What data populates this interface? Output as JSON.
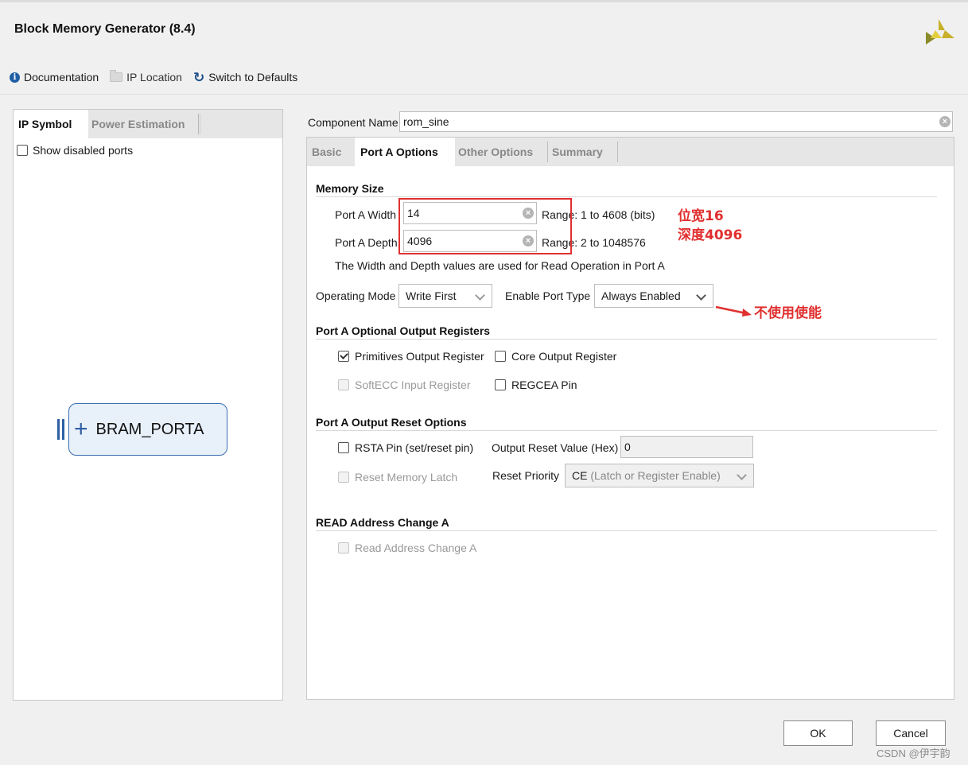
{
  "window": {
    "title": "Block Memory Generator (8.4)"
  },
  "toolbar": {
    "documentation": "Documentation",
    "ip_location": "IP Location",
    "switch_defaults": "Switch to Defaults"
  },
  "left_panel": {
    "tabs": [
      "IP Symbol",
      "Power Estimation"
    ],
    "show_disabled_ports": "Show disabled ports",
    "symbol": {
      "plus": "+",
      "label": "BRAM_PORTA"
    }
  },
  "component": {
    "label": "Component Name",
    "value": "rom_sine"
  },
  "right_tabs": [
    "Basic",
    "Port A Options",
    "Other Options",
    "Summary"
  ],
  "memory_size": {
    "title": "Memory Size",
    "width_label": "Port A Width",
    "width_value": "14",
    "width_range": "Range: 1 to 4608 (bits)",
    "depth_label": "Port A Depth",
    "depth_value": "4096",
    "depth_range": "Range: 2 to 1048576",
    "note": "The Width and Depth values are used for Read Operation in Port A"
  },
  "operating": {
    "mode_label": "Operating Mode",
    "mode_value": "Write First",
    "port_type_label": "Enable Port Type",
    "port_type_value": "Always Enabled"
  },
  "output_registers": {
    "title": "Port A Optional Output Registers",
    "primitives": {
      "label": "Primitives Output Register",
      "checked": true
    },
    "core": {
      "label": "Core Output Register",
      "checked": false
    },
    "softecc": {
      "label": "SoftECC Input Register",
      "checked": false,
      "disabled": true
    },
    "regcea": {
      "label": "REGCEA Pin",
      "checked": false
    }
  },
  "reset_options": {
    "title": "Port A Output Reset Options",
    "rsta": {
      "label": "RSTA Pin (set/reset pin)",
      "checked": false
    },
    "reset_value_label": "Output Reset Value (Hex)",
    "reset_value": "0",
    "reset_latch": {
      "label": "Reset Memory Latch",
      "checked": false,
      "disabled": true
    },
    "priority_label": "Reset Priority",
    "priority_value_prefix": "CE",
    "priority_value_rest": " (Latch or Register Enable)"
  },
  "read_address": {
    "title": "READ Address Change A",
    "checkbox": {
      "label": "Read Address Change A",
      "checked": false,
      "disabled": true
    }
  },
  "annotations": {
    "width_note": "位宽16",
    "depth_note": "深度4096",
    "enable_note": "不使用使能",
    "color": "#e0302f"
  },
  "buttons": {
    "ok": "OK",
    "cancel": "Cancel"
  },
  "watermark": "CSDN @伊宇韵"
}
